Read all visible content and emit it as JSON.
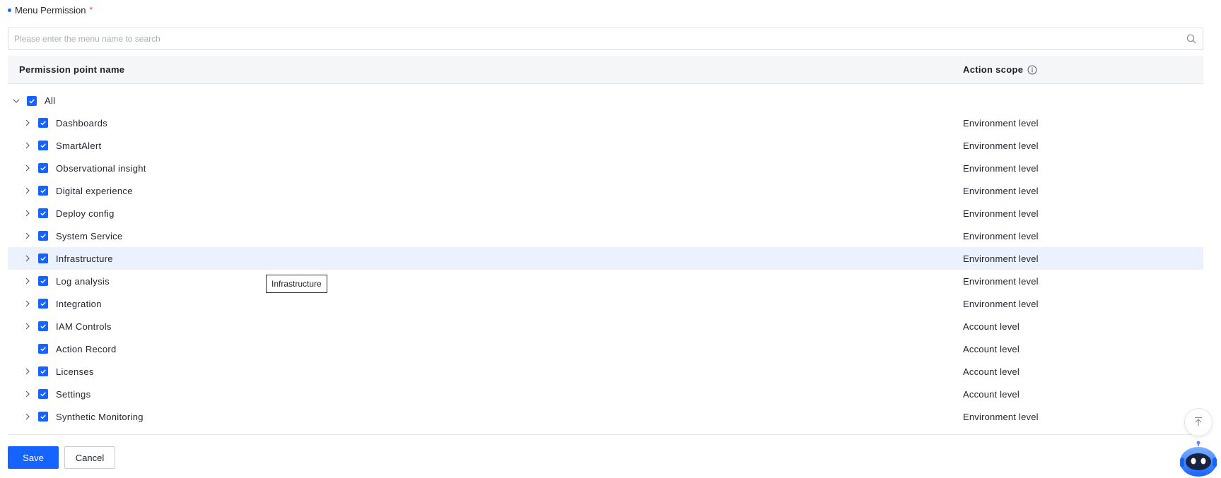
{
  "section": {
    "title": "Menu Permission",
    "required_mark": "*"
  },
  "search": {
    "placeholder": "Please enter the menu name to search",
    "value": ""
  },
  "table": {
    "col_name": "Permission point name",
    "col_scope": "Action scope"
  },
  "rows": [
    {
      "label": "All",
      "scope": "",
      "level": 0,
      "expanded": true,
      "checked": true
    },
    {
      "label": "Dashboards",
      "scope": "Environment level",
      "level": 1,
      "expandable": true,
      "checked": true
    },
    {
      "label": "SmartAlert",
      "scope": "Environment level",
      "level": 1,
      "expandable": true,
      "checked": true
    },
    {
      "label": "Observational insight",
      "scope": "Environment level",
      "level": 1,
      "expandable": true,
      "checked": true
    },
    {
      "label": "Digital experience",
      "scope": "Environment level",
      "level": 1,
      "expandable": true,
      "checked": true
    },
    {
      "label": "Deploy config",
      "scope": "Environment level",
      "level": 1,
      "expandable": true,
      "checked": true
    },
    {
      "label": "System Service",
      "scope": "Environment level",
      "level": 1,
      "expandable": true,
      "checked": true
    },
    {
      "label": "Infrastructure",
      "scope": "Environment level",
      "level": 1,
      "expandable": true,
      "checked": true,
      "hovered": true
    },
    {
      "label": "Log analysis",
      "scope": "Environment level",
      "level": 1,
      "expandable": true,
      "checked": true
    },
    {
      "label": "Integration",
      "scope": "Environment level",
      "level": 1,
      "expandable": true,
      "checked": true
    },
    {
      "label": "IAM Controls",
      "scope": "Account level",
      "level": 1,
      "expandable": true,
      "checked": true
    },
    {
      "label": "Action Record",
      "scope": "Account level",
      "level": 1,
      "expandable": false,
      "checked": true
    },
    {
      "label": "Licenses",
      "scope": "Account level",
      "level": 1,
      "expandable": true,
      "checked": true
    },
    {
      "label": "Settings",
      "scope": "Account level",
      "level": 1,
      "expandable": true,
      "checked": true
    },
    {
      "label": "Synthetic Monitoring",
      "scope": "Environment level",
      "level": 1,
      "expandable": true,
      "checked": true
    }
  ],
  "tooltip": {
    "text": "Infrastructure"
  },
  "buttons": {
    "save": "Save",
    "cancel": "Cancel"
  },
  "icons": {
    "search": "search-icon",
    "info": "info-icon",
    "expand": "chevron-right-icon",
    "collapse": "chevron-down-icon",
    "checkbox": "checkbox-checked-icon",
    "back_to_top": "back-to-top-icon",
    "assistant": "robot-assistant-icon"
  },
  "colors": {
    "primary": "#1664ff",
    "required": "#f53f3f",
    "row_hover": "#ebf2fd",
    "header_bg": "#f5f6f8"
  }
}
